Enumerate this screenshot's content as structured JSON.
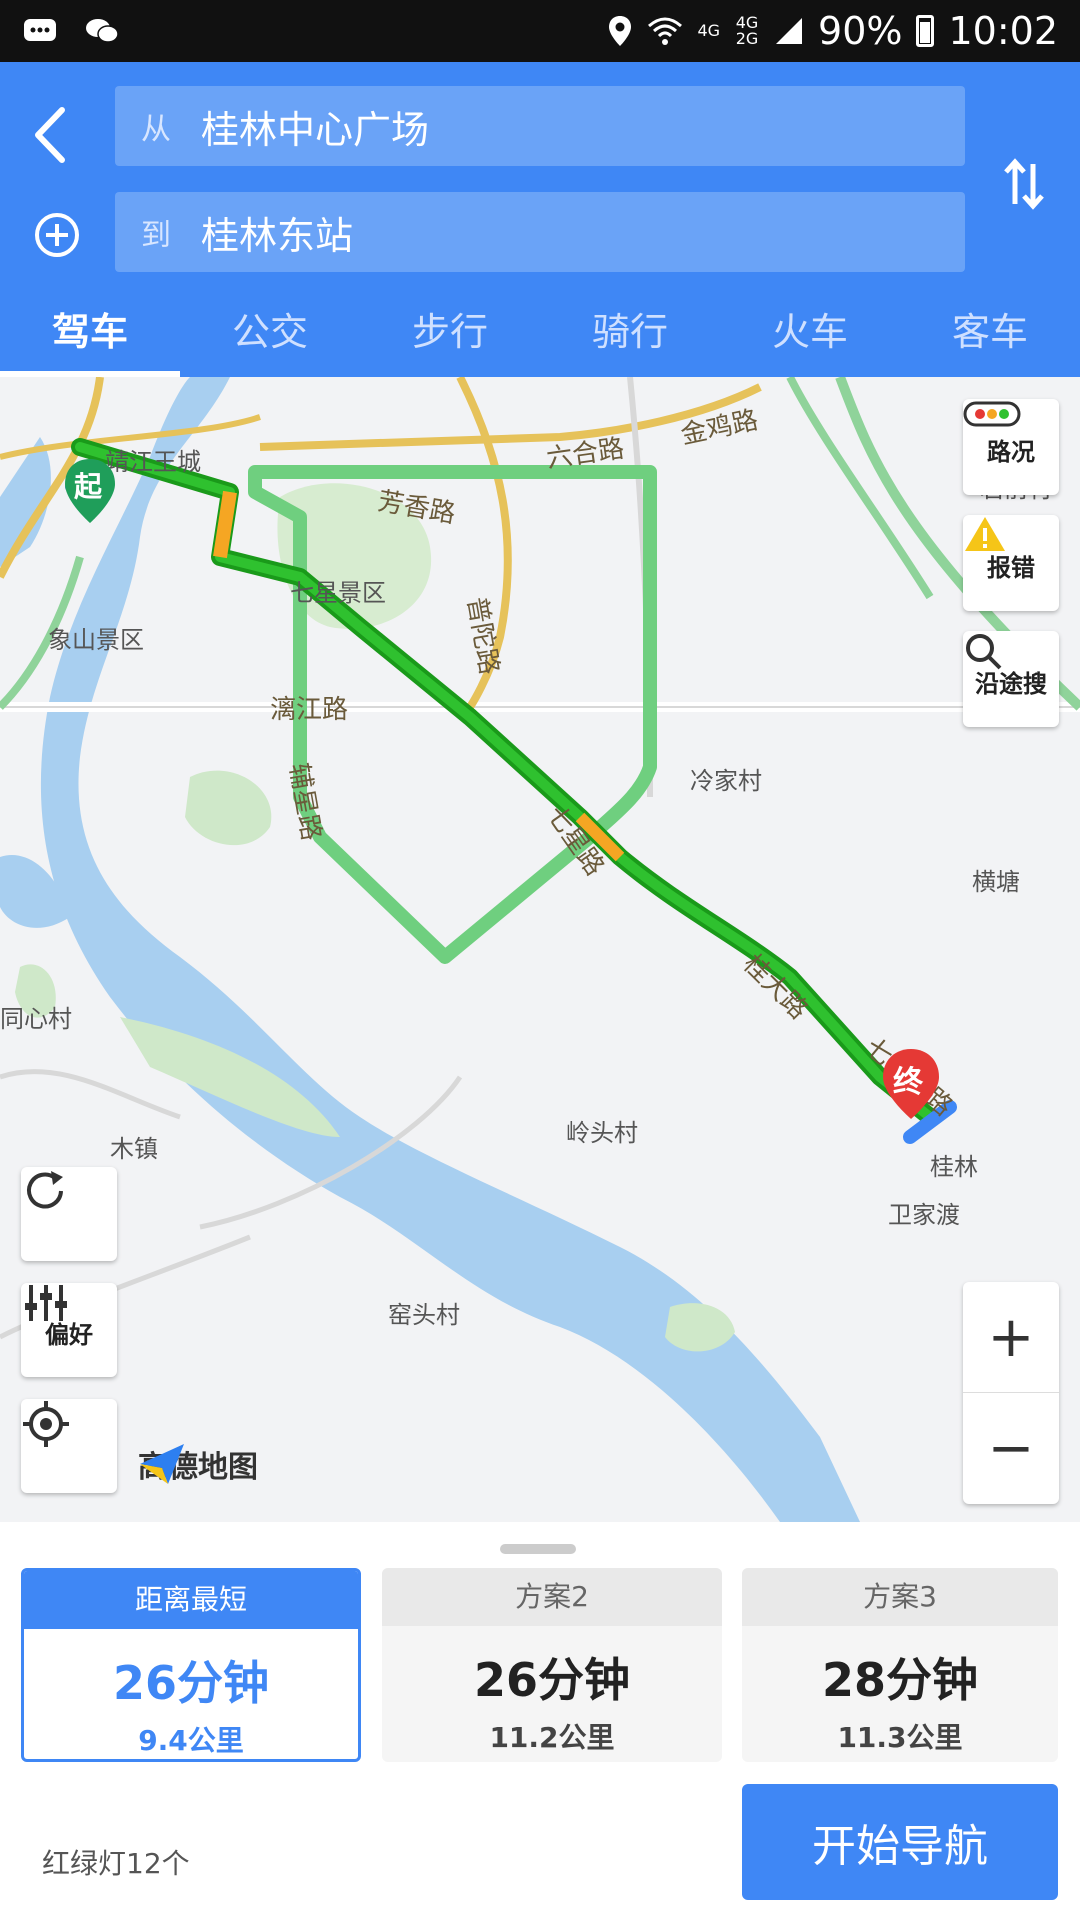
{
  "status_bar": {
    "signal_text": "4G",
    "signal_text2": "4G 2G",
    "battery": "90%",
    "time": "10:02"
  },
  "header": {
    "from_prefix": "从",
    "from_value": "桂林中心广场",
    "to_prefix": "到",
    "to_value": "桂林东站",
    "icons": {
      "back": "back-arrow-icon",
      "add": "add-circle-icon",
      "swap": "swap-icon"
    },
    "accent": "#3f87f5"
  },
  "tabs": [
    {
      "label": "驾车",
      "active": true
    },
    {
      "label": "公交",
      "active": false
    },
    {
      "label": "步行",
      "active": false
    },
    {
      "label": "骑行",
      "active": false
    },
    {
      "label": "火车",
      "active": false
    },
    {
      "label": "客车",
      "active": false
    }
  ],
  "map": {
    "places": [
      "靖江王城",
      "象山景区",
      "七星景区",
      "冷家村",
      "横塘",
      "岩前村",
      "同心村",
      "木镇",
      "岭头村",
      "卫家渡",
      "窑头村",
      "桂林"
    ],
    "roads": [
      "六合路",
      "金鸡路",
      "芳香路",
      "普陀路",
      "漓江路",
      "辅星路",
      "七星路",
      "桂大路",
      "七里店路"
    ],
    "start_label": "起",
    "end_label": "终",
    "controls": {
      "traffic": "路况",
      "report": "报错",
      "search_along": "沿途搜",
      "preference": "偏好",
      "zoom_in": "+",
      "zoom_out": "−"
    },
    "logo_text": "高德地图",
    "route_colors": {
      "main": "#1fa31f",
      "alt": "#7fd58a",
      "slow": "#f5a623"
    }
  },
  "plans": [
    {
      "title": "距离最短",
      "time": "26分钟",
      "distance": "9.4公里",
      "selected": true
    },
    {
      "title": "方案2",
      "time": "26分钟",
      "distance": "11.2公里",
      "selected": false
    },
    {
      "title": "方案3",
      "time": "28分钟",
      "distance": "11.3公里",
      "selected": false
    }
  ],
  "footer": {
    "traffic_lights": "红绿灯12个",
    "start_nav": "开始导航"
  }
}
